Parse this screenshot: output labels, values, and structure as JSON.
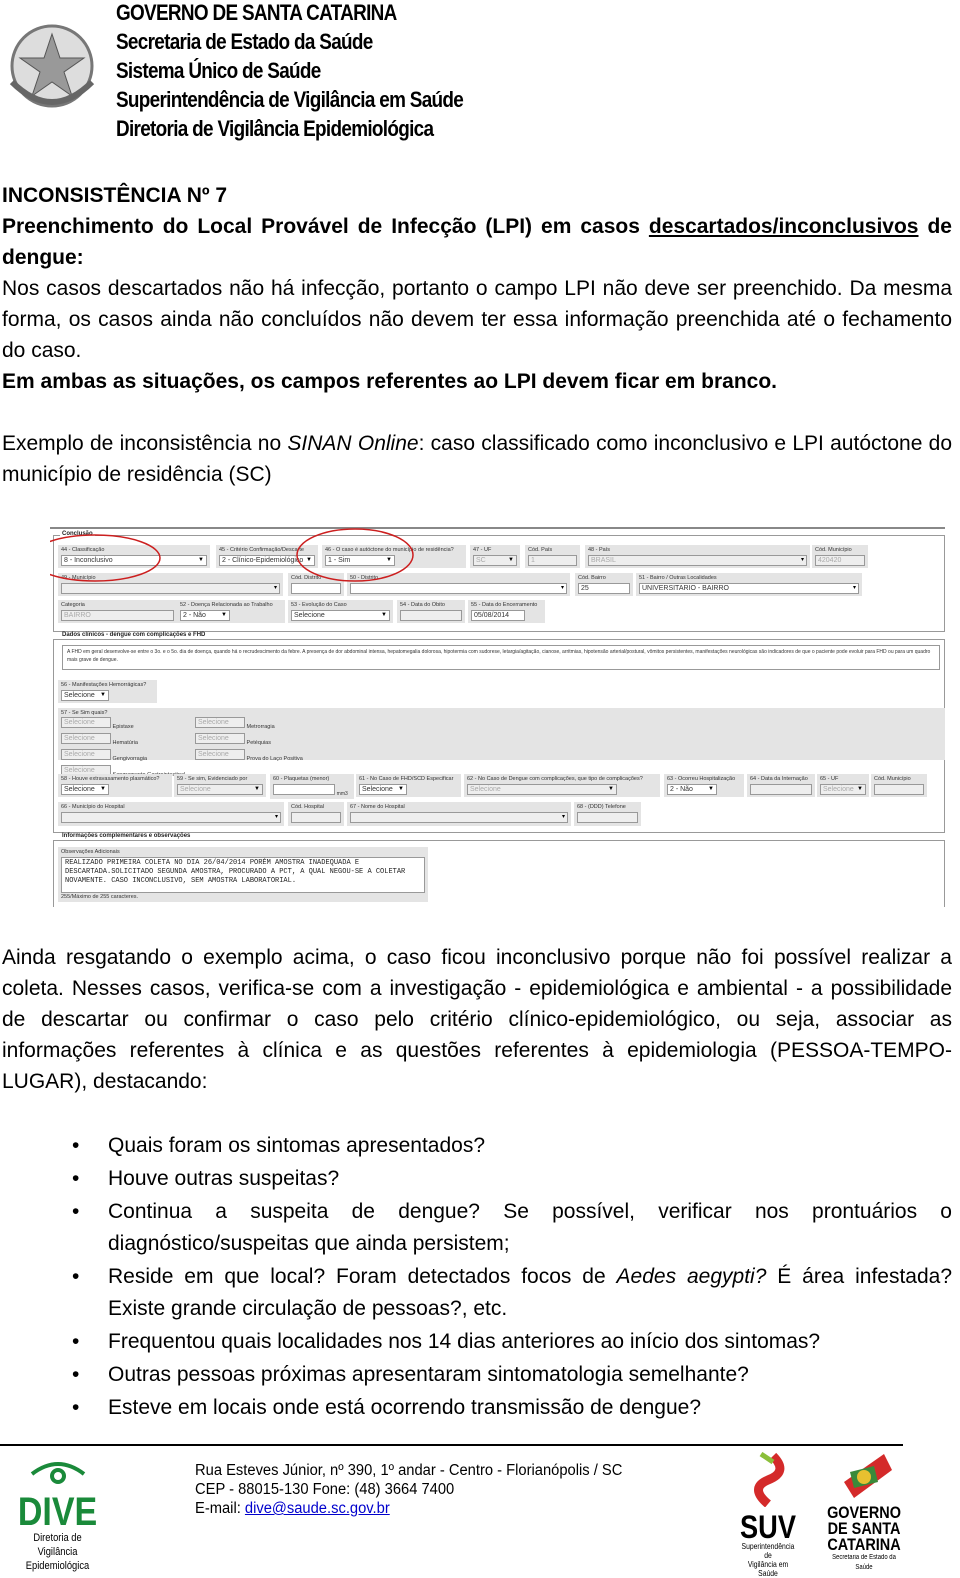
{
  "header": {
    "lines": [
      "GOVERNO DE SANTA CATARINA",
      "Secretaria de Estado da Saúde",
      "Sistema Único de Saúde",
      "Superintendência de Vigilância em Saúde",
      "Diretoria de Vigilância Epidemiológica"
    ],
    "seal_logo": "brasao-santa-catarina"
  },
  "section": {
    "title": "INCONSISTÊNCIA Nº 7",
    "subtitle_part1": "Preenchimento do Local Provável de Infecção (LPI) em casos ",
    "subtitle_underlined": "descartados/inconclusivos",
    "subtitle_part2": " de dengue:",
    "para1": "Nos casos descartados não há infecção, portanto o campo LPI não deve ser preenchido. Da mesma forma, os casos ainda não concluídos não devem ter essa informação preenchida até o fechamento do caso.",
    "para1_bold": "Em ambas as situações, os campos referentes ao LPI devem ficar em branco.",
    "example_part1": "Exemplo de inconsistência no ",
    "example_italic": "SINAN Online",
    "example_part2": ": caso classificado como inconclusivo e LPI autóctone do município de residência (SC)"
  },
  "form": {
    "conclusao_title": "Conclusão",
    "f44": {
      "label": "44 - Classificação",
      "value": "8 - Inconclusivo"
    },
    "f45": {
      "label": "45 - Critério Confirmação/Descarte",
      "value": "2 - Clínico-Epidemiológico"
    },
    "f46": {
      "label": "46 - O caso é autóctone do município de residência?",
      "value": "1 - Sim"
    },
    "f47": {
      "label": "47 - UF",
      "value": "SC"
    },
    "cod_pais": {
      "label": "Cód. País",
      "value": "1"
    },
    "f48": {
      "label": "48 - País",
      "value": "BRASIL"
    },
    "cod_municipio": {
      "label": "Cód. Município",
      "value": "420420"
    },
    "f49": {
      "label": "49 - Município",
      "value": ""
    },
    "cod_distrito": {
      "label": "Cód. Distrito",
      "value": ""
    },
    "f50": {
      "label": "50 - Distrito",
      "value": ""
    },
    "cod_bairro": {
      "label": "Cód. Bairro",
      "value": "25"
    },
    "f51": {
      "label": "51 - Bairro / Outras Localidades",
      "value": "UNIVERSITARIO - BAIRRO"
    },
    "categoria": {
      "label": "Categoria",
      "value": "BAIRRO"
    },
    "f52": {
      "label": "52 - Doença Relacionada ao Trabalho",
      "value": "2 - Não"
    },
    "f53": {
      "label": "53 - Evolução do Caso",
      "value": "Selecione"
    },
    "f54": {
      "label": "54 - Data do Óbito",
      "value": ""
    },
    "f55": {
      "label": "55 - Data do Encerramento",
      "value": "05/08/2014"
    },
    "clinicos_title": "Dados clínicos - dengue com complicações e FHD",
    "clinicos_note": "A FHD em geral desenvolve-se entre o 3o. e o 5o. dia de doença, quando há o recrudescimento da febre. A presença de dor abdominal intensa, hepatomegalia dolorosa, hipotermia com sudorese, letargia/agitação, cianose, arritmias, hipotensão arterial/postural, vômitos persistentes, manifestações neurológicas são indicadores de que o paciente pode evoluir para FHD ou para um quadro mais grave de dengue.",
    "f56": {
      "label": "56 - Manifestações Hemorrágicas?",
      "value": "Selecione"
    },
    "f57": {
      "label": "57 - Se Sim quais?",
      "select": "Selecione",
      "items": [
        "Epistaxe",
        "Hematúria",
        "Gengivorragia",
        "Sangramento Gastrointestinal",
        "Metrorragia",
        "Petéquias",
        "Prova do Laço Positiva"
      ]
    },
    "f58": {
      "label": "58 - Houve extravasamento plasmático?",
      "value": "Selecione"
    },
    "f59": {
      "label": "59 - Se sim, Evidenciado por",
      "value": "Selecione"
    },
    "f60": {
      "label": "60 - Plaquetas (menor)",
      "value": "",
      "unit": "mm3"
    },
    "f61": {
      "label": "61 - No Caso de FHD/SCD Especificar",
      "value": "Selecione"
    },
    "f62": {
      "label": "62 - No Caso de Dengue com complicações, que tipo de complicações?",
      "value": "Selecione"
    },
    "f63": {
      "label": "63 - Ocorreu Hospitalização",
      "value": "2 - Não"
    },
    "f64": {
      "label": "64 - Data da Internação",
      "value": ""
    },
    "f65": {
      "label": "65 - UF",
      "value": "Selecione"
    },
    "cod_municipio2": {
      "label": "Cód. Município",
      "value": ""
    },
    "f66": {
      "label": "66 - Município do Hospital",
      "value": ""
    },
    "cod_hospital": {
      "label": "Cód. Hospital",
      "value": ""
    },
    "f67": {
      "label": "67 - Nome do Hospital",
      "value": ""
    },
    "f68": {
      "label": "68 - (DDD) Telefone",
      "value": ""
    },
    "info_title": "Informações complementares e observações",
    "obs": {
      "label": "Observações Adicionais",
      "value": "REALIZADO PRIMEIRA COLETA NO DIA 26/04/2014 PORÉM AMOSTRA INADEQUADA E DESCARTADA.SOLICITADO SEGUNDA AMOSTRA, PROCURADO A PCT, A QUAL NEGOU-SE A COLETAR NOVAMENTE. CASO INCONCLUSIVO, SEM AMOSTRA LABORATORIAL.",
      "counter": "255/Máximo de 255 caracteres."
    },
    "highlight_color": "#cc1f1f"
  },
  "para2": "Ainda resgatando o exemplo acima, o caso ficou inconclusivo porque não foi possível realizar a coleta. Nesses casos, verifica-se com a investigação - epidemiológica e ambiental - a possibilidade de descartar ou confirmar o caso pelo critério clínico-epidemiológico, ou seja, associar as informações referentes à clínica e as questões referentes à epidemiologia (PESSOA-TEMPO-LUGAR), destacando:",
  "bullets": {
    "b1": "Quais foram os sintomas apresentados?",
    "b2": "Houve outras suspeitas?",
    "b3": "Continua a suspeita de dengue? Se possível, verificar nos prontuários o diagnóstico/suspeitas que ainda persistem;",
    "b4_part1": "Reside em que local? Foram detectados focos de ",
    "b4_italic": "Aedes aegypti?",
    "b4_part2": " É área infestada? Existe grande circulação de pessoas?, etc.",
    "b5": "Frequentou quais localidades nos 14 dias anteriores ao início dos sintomas?",
    "b6": "Outras pessoas próximas apresentaram sintomatologia semelhante?",
    "b7": "Esteve em locais onde está ocorrendo transmissão de dengue?"
  },
  "footer": {
    "address": "Rua Esteves Júnior, nº 390, 1º andar - Centro - Florianópolis / SC",
    "cep_phone": "CEP - 88015-130 Fone: (48) 3664 7400",
    "email_label": "E-mail: ",
    "email": "dive@saude.sc.gov.br",
    "dive_logo": {
      "name": "DIVE",
      "sub1": "Diretoria de Vigilância",
      "sub2": "Epidemiológica",
      "color": "#1a8a3a"
    },
    "suv_logo": {
      "name": "SUV",
      "sub1": "Superintendência de",
      "sub2": "Vigilância em Saúde"
    },
    "gov_logo": {
      "line1": "GOVERNO",
      "line2": "DE SANTA",
      "line3": "CATARINA",
      "sub": "Secretaria de Estado da Saúde"
    }
  }
}
